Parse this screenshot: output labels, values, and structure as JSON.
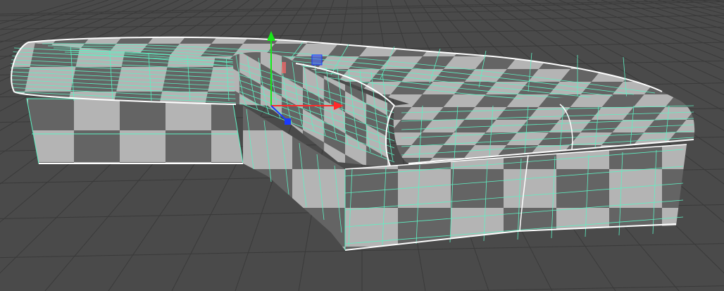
{
  "viewport": {
    "background": "#4a4a4a",
    "grid_color": "#3a3a3a"
  },
  "model": {
    "checker_light": "#b4b4b4",
    "checker_dark": "#646464",
    "wireframe_color": "#5ef0c2",
    "edge_highlight_color": "#ffffff"
  },
  "gizmo": {
    "y_axis_color": "#19e619",
    "x_axis_color": "#ff2a2a",
    "z_axis_color": "#1a3aff",
    "plane_handle_color": "#4a6aff"
  }
}
